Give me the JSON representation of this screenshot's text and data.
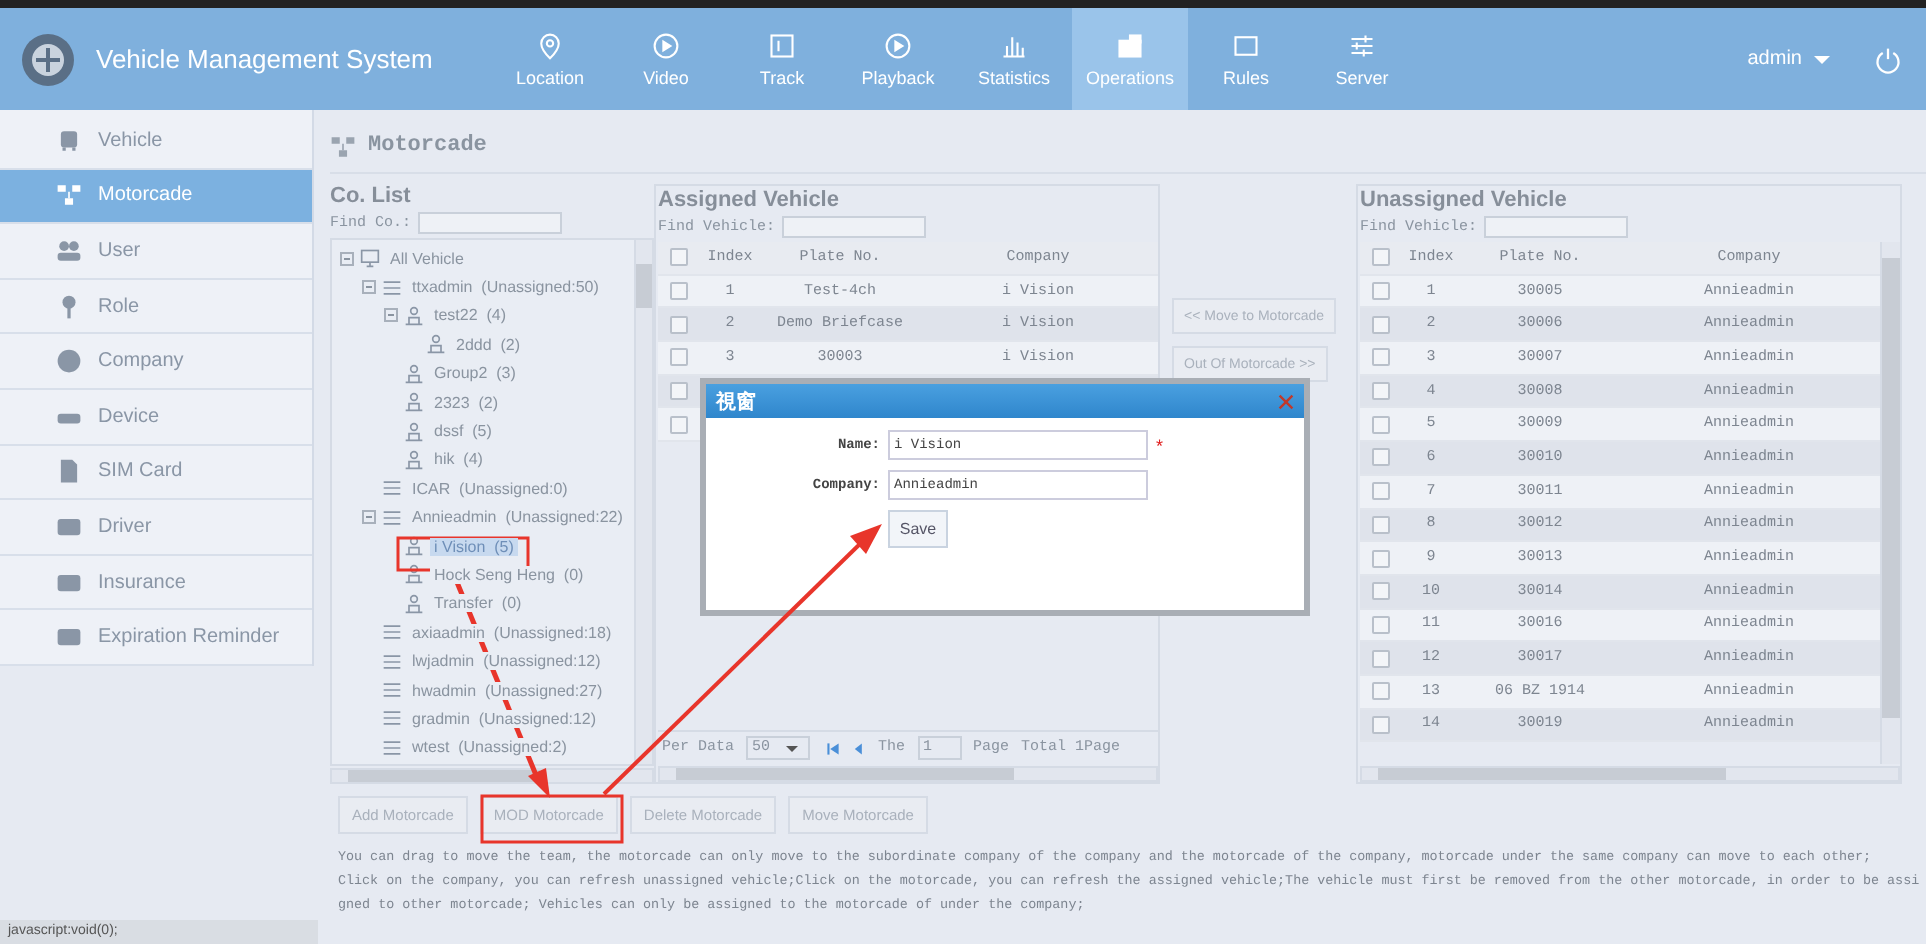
{
  "header": {
    "title": "Vehicle Management System",
    "nav": [
      {
        "label": "Location",
        "selected": false
      },
      {
        "label": "Video",
        "selected": false
      },
      {
        "label": "Track",
        "selected": false
      },
      {
        "label": "Playback",
        "selected": false
      },
      {
        "label": "Statistics",
        "selected": false
      },
      {
        "label": "Operations",
        "selected": true
      },
      {
        "label": "Rules",
        "selected": false
      },
      {
        "label": "Server",
        "selected": false
      }
    ],
    "user": "admin"
  },
  "sidebar": {
    "items": [
      {
        "label": "Vehicle",
        "selected": false
      },
      {
        "label": "Motorcade",
        "selected": true
      },
      {
        "label": "User",
        "selected": false
      },
      {
        "label": "Role",
        "selected": false
      },
      {
        "label": "Company",
        "selected": false
      },
      {
        "label": "Device",
        "selected": false
      },
      {
        "label": "SIM Card",
        "selected": false
      },
      {
        "label": "Driver",
        "selected": false
      },
      {
        "label": "Insurance",
        "selected": false
      },
      {
        "label": "Expiration Reminder",
        "selected": false
      }
    ]
  },
  "page_title": "Motorcade",
  "co_list": {
    "title": "Co. List",
    "find_label": "Find Co.:",
    "tree": [
      {
        "label": "All Vehicle",
        "kind": "root",
        "expanded": true,
        "selected": false,
        "children": [
          {
            "label": "ttxadmin  (Unassigned:50)",
            "kind": "company",
            "expanded": true,
            "selected": false,
            "children": [
              {
                "label": "test22  (4)",
                "kind": "motorcade",
                "expanded": true,
                "selected": false,
                "children": [
                  {
                    "label": "2ddd  (2)",
                    "kind": "motorcade",
                    "selected": false
                  }
                ]
              },
              {
                "label": "Group2  (3)",
                "kind": "motorcade",
                "selected": false
              },
              {
                "label": "2323  (2)",
                "kind": "motorcade",
                "selected": false
              },
              {
                "label": "dssf  (5)",
                "kind": "motorcade",
                "selected": false
              },
              {
                "label": "hik  (4)",
                "kind": "motorcade",
                "selected": false
              }
            ]
          },
          {
            "label": "ICAR  (Unassigned:0)",
            "kind": "company",
            "selected": false
          },
          {
            "label": "Annieadmin  (Unassigned:22)",
            "kind": "company",
            "expanded": true,
            "selected": false,
            "children": [
              {
                "label": "i Vision  (5)",
                "kind": "motorcade",
                "selected": true
              },
              {
                "label": "Hock Seng Heng  (0)",
                "kind": "motorcade",
                "selected": false
              },
              {
                "label": "Transfer  (0)",
                "kind": "motorcade",
                "selected": false
              }
            ]
          },
          {
            "label": "axiaadmin  (Unassigned:18)",
            "kind": "company",
            "selected": false
          },
          {
            "label": "lwjadmin  (Unassigned:12)",
            "kind": "company",
            "selected": false
          },
          {
            "label": "hwadmin  (Unassigned:27)",
            "kind": "company",
            "selected": false
          },
          {
            "label": "gradmin  (Unassigned:12)",
            "kind": "company",
            "selected": false
          },
          {
            "label": "wtest  (Unassigned:2)",
            "kind": "company",
            "selected": false
          }
        ]
      }
    ]
  },
  "assigned": {
    "title": "Assigned Vehicle",
    "find_label": "Find Vehicle:",
    "all_checked": false,
    "columns": [
      "Index",
      "Plate No.",
      "Company"
    ],
    "rows": [
      {
        "checked": false,
        "cells": [
          "1",
          "Test-4ch",
          "i Vision"
        ]
      },
      {
        "checked": false,
        "cells": [
          "2",
          "Demo Briefcase",
          "i Vision"
        ]
      },
      {
        "checked": false,
        "cells": [
          "3",
          "30003",
          "i Vision"
        ]
      },
      {
        "checked": false
      },
      {
        "checked": false
      }
    ],
    "pager": {
      "per_label": "Per Data",
      "per_value": "50",
      "the_label": "The",
      "page_value": "1",
      "page_label": "Page",
      "total": "Total 1Page"
    }
  },
  "move_buttons": [
    "<< Move to Motorcade",
    "Out Of Motorcade >>"
  ],
  "unassigned": {
    "title": "Unassigned Vehicle",
    "find_label": "Find Vehicle:",
    "all_checked": false,
    "columns": [
      "Index",
      "Plate No.",
      "Company"
    ],
    "rows": [
      {
        "checked": false,
        "cells": [
          "1",
          "30005",
          "Annieadmin"
        ]
      },
      {
        "checked": false,
        "cells": [
          "2",
          "30006",
          "Annieadmin"
        ]
      },
      {
        "checked": false,
        "cells": [
          "3",
          "30007",
          "Annieadmin"
        ]
      },
      {
        "checked": false,
        "cells": [
          "4",
          "30008",
          "Annieadmin"
        ]
      },
      {
        "checked": false,
        "cells": [
          "5",
          "30009",
          "Annieadmin"
        ]
      },
      {
        "checked": false,
        "cells": [
          "6",
          "30010",
          "Annieadmin"
        ]
      },
      {
        "checked": false,
        "cells": [
          "7",
          "30011",
          "Annieadmin"
        ]
      },
      {
        "checked": false,
        "cells": [
          "8",
          "30012",
          "Annieadmin"
        ]
      },
      {
        "checked": false,
        "cells": [
          "9",
          "30013",
          "Annieadmin"
        ]
      },
      {
        "checked": false,
        "cells": [
          "10",
          "30014",
          "Annieadmin"
        ]
      },
      {
        "checked": false,
        "cells": [
          "11",
          "30016",
          "Annieadmin"
        ]
      },
      {
        "checked": false,
        "cells": [
          "12",
          "30017",
          "Annieadmin"
        ]
      },
      {
        "checked": false,
        "cells": [
          "13",
          "06 BZ 1914",
          "Annieadmin"
        ]
      },
      {
        "checked": false,
        "cells": [
          "14",
          "30019",
          "Annieadmin"
        ]
      }
    ]
  },
  "actions": [
    "Add Motorcade",
    "MOD Motorcade",
    "Delete Motorcade",
    "Move Motorcade"
  ],
  "notes": [
    "You can drag to move the team, the motorcade can only move to the subordinate company of the company and the motorcade of the company, motorcade under the same company can move to each other;",
    "Click on the company, you can refresh unassigned vehicle;Click on the motorcade, you can refresh the assigned vehicle;The vehicle must first be removed from the other motorcade, in order to be assigned to other motorcade; Vehicles can only be assigned to the motorcade of under the company;"
  ],
  "dialog": {
    "title": "視窗",
    "fields": [
      {
        "label": "Name:",
        "value": "i Vision",
        "required": true
      },
      {
        "label": "Company:",
        "value": "Annieadmin"
      }
    ],
    "required_mark": "*",
    "save": "Save"
  },
  "status_bar": "javascript:void(0);"
}
